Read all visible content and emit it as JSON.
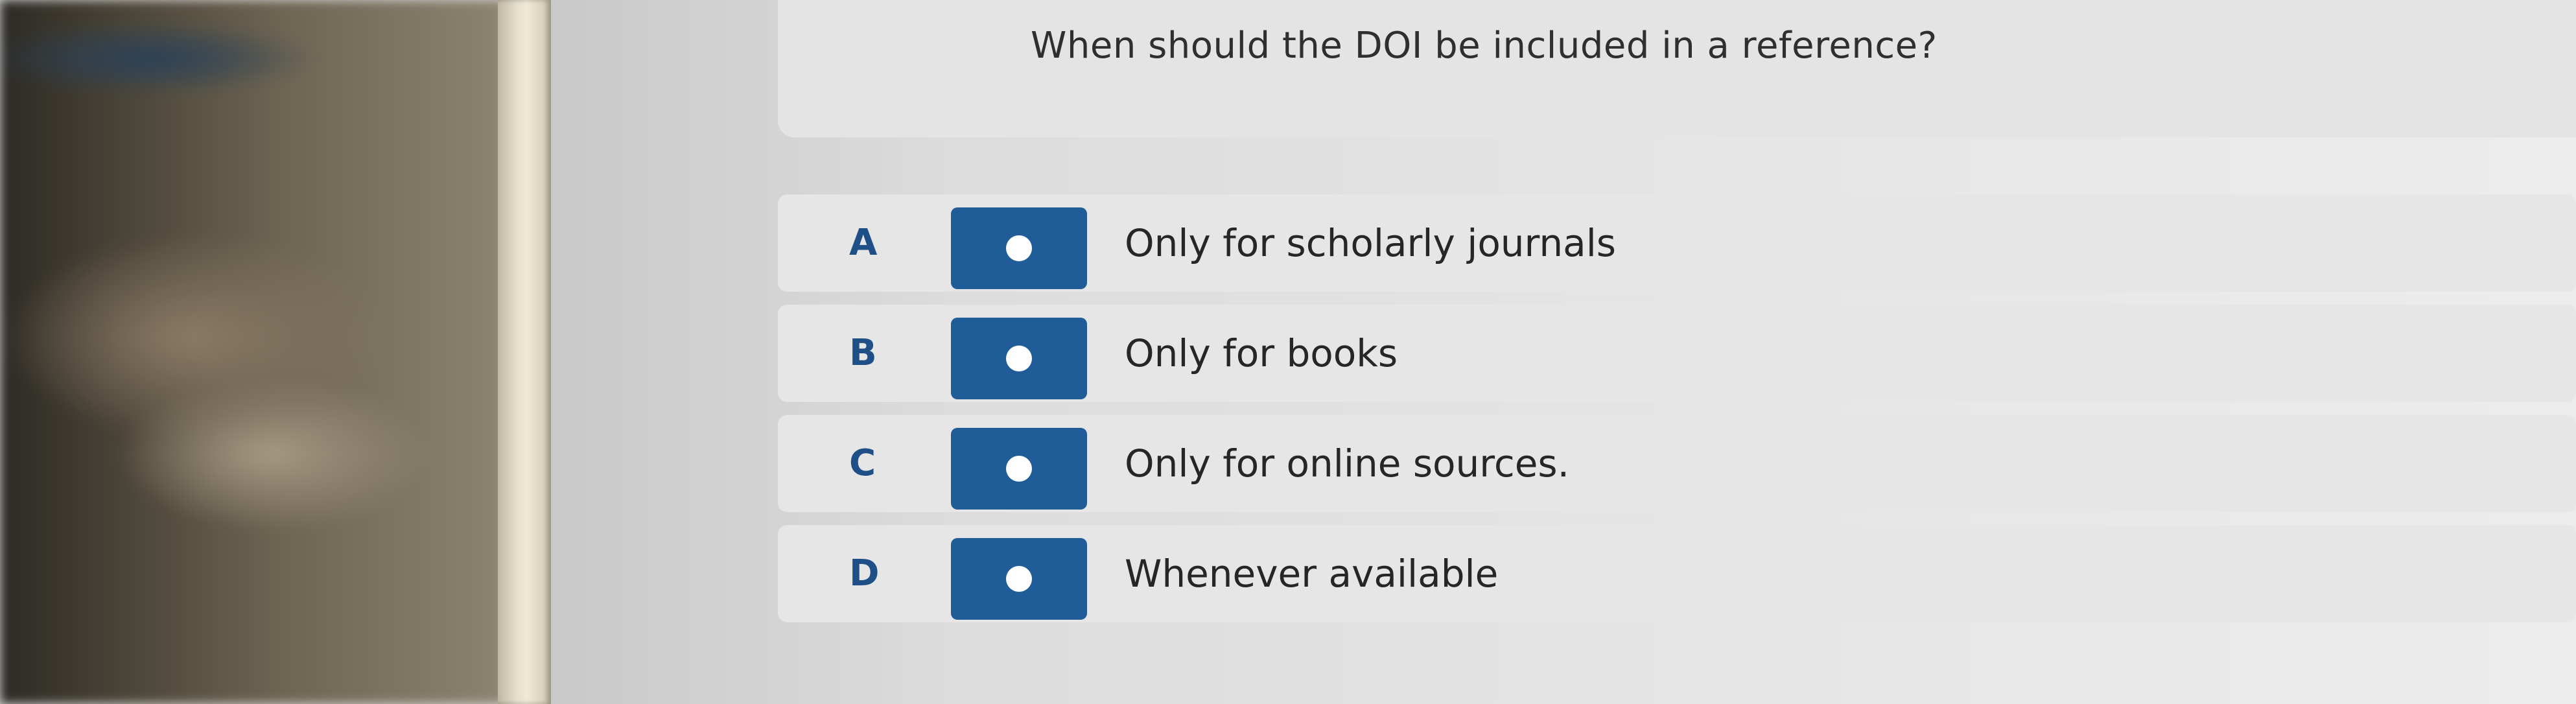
{
  "question": {
    "text": "When should the DOI be included in a reference?"
  },
  "options": [
    {
      "letter": "A",
      "label": "Only for scholarly journals"
    },
    {
      "letter": "B",
      "label": "Only for books"
    },
    {
      "letter": "C",
      "label": "Only for online sources."
    },
    {
      "letter": "D",
      "label": "Whenever available"
    }
  ],
  "colors": {
    "button_blue": "#1f5c98",
    "letter_blue": "#1e4f86"
  }
}
